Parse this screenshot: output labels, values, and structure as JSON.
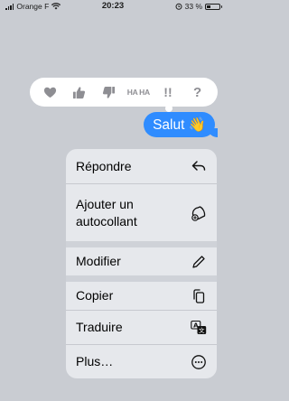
{
  "status_bar": {
    "carrier": "Orange F",
    "time": "20:23",
    "battery": "33 %",
    "battery_level": 0.33
  },
  "reactions": [
    {
      "name": "heart",
      "icon": "heart-icon"
    },
    {
      "name": "thumbs-up",
      "icon": "thumbs-up-icon"
    },
    {
      "name": "thumbs-down",
      "icon": "thumbs-down-icon"
    },
    {
      "name": "haha",
      "label": "HA HA"
    },
    {
      "name": "emphasize",
      "label": "!!"
    },
    {
      "name": "question",
      "label": "?"
    }
  ],
  "message": {
    "text": "Salut 👋",
    "color": "#2f8cff"
  },
  "menu": {
    "reply": "Répondre",
    "sticker": "Ajouter un autocollant",
    "edit": "Modifier",
    "copy": "Copier",
    "translate": "Traduire",
    "more": "Plus…"
  }
}
